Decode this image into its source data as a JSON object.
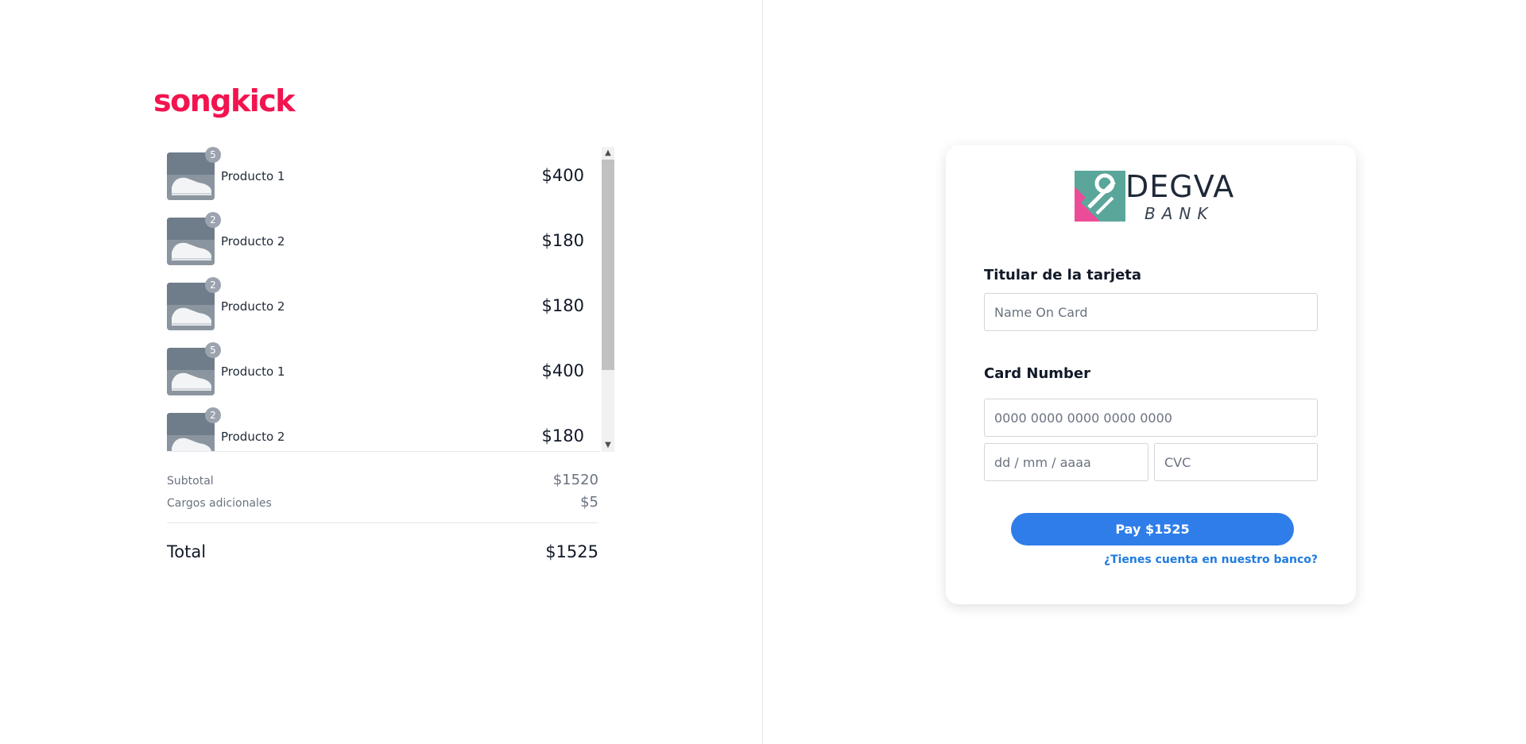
{
  "brand": {
    "name": "songkick",
    "color": "#f2134f"
  },
  "cart": {
    "items": [
      {
        "qty": "5",
        "name": "Producto 1",
        "price": "$400"
      },
      {
        "qty": "2",
        "name": "Producto 2",
        "price": "$180"
      },
      {
        "qty": "2",
        "name": "Producto 2",
        "price": "$180"
      },
      {
        "qty": "5",
        "name": "Producto 1",
        "price": "$400"
      },
      {
        "qty": "2",
        "name": "Producto 2",
        "price": "$180"
      }
    ]
  },
  "summary": {
    "subtotal_label": "Subtotal",
    "subtotal_value": "$1520",
    "fees_label": "Cargos adicionales",
    "fees_value": "$5",
    "total_label": "Total",
    "total_value": "$1525"
  },
  "bank": {
    "name": "DEGVA",
    "subtitle": "BANK",
    "logo_colors": {
      "teal": "#5aa69a",
      "pink": "#ec4c97"
    }
  },
  "form": {
    "holder_label": "Titular de la tarjeta",
    "holder_placeholder": "Name On Card",
    "card_label": "Card Number",
    "card_placeholder": "0000 0000 0000 0000 0000",
    "date_placeholder": "dd / mm / aaaa",
    "cvc_placeholder": "CVC",
    "pay_label": "Pay $1525",
    "bank_link": "¿Tienes cuenta en nuestro banco?"
  },
  "colors": {
    "accent": "#2f7de9",
    "link": "#1f7be0"
  }
}
